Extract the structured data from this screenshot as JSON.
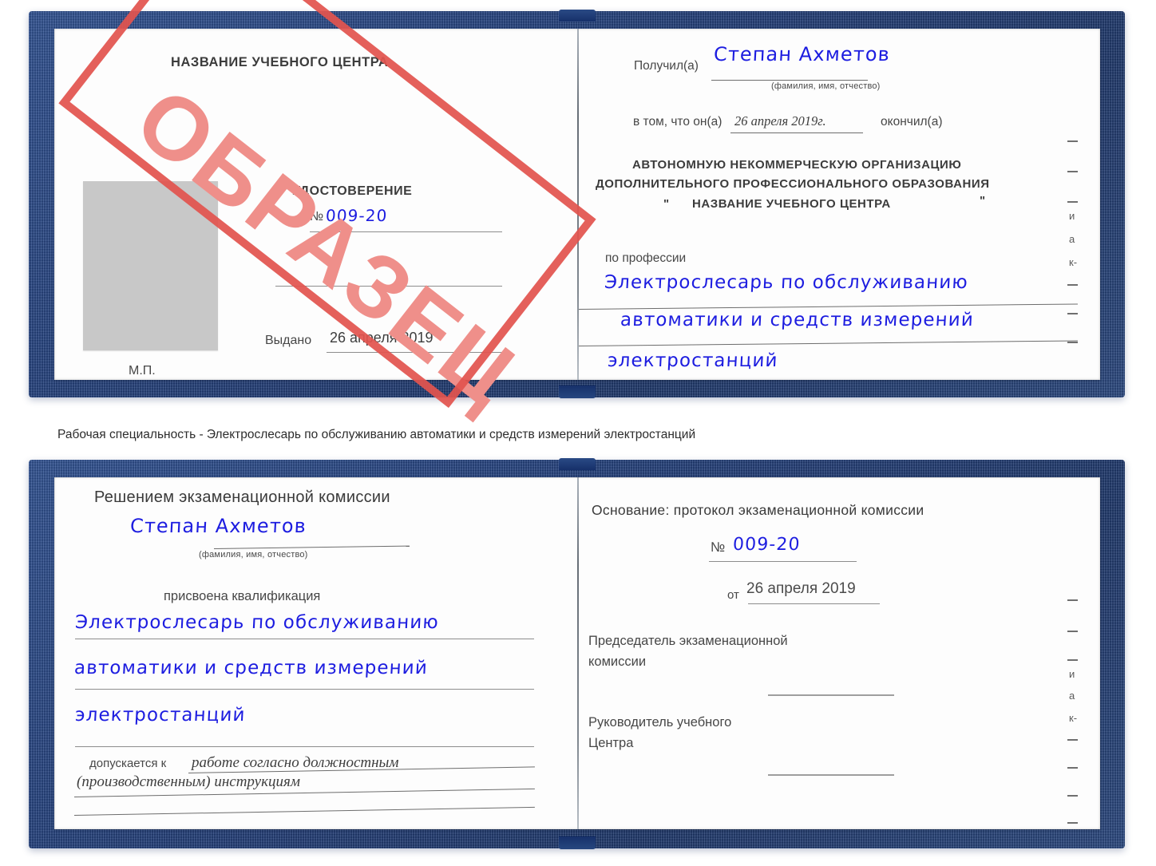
{
  "document": {
    "type": "Удостоверение",
    "watermark": {
      "text": "ОБРАЗЕЦ",
      "border_color": "#e2544f",
      "text_color": "#ef8f8a",
      "angle_deg": -38
    },
    "cover_color": "#1d3c7c",
    "handwriting_color": "#1d1de0"
  },
  "caption": {
    "text": "Рабочая специальность - Электрослесарь по обслуживанию автоматики и средств измерений электростанций"
  },
  "cert1": {
    "left_page": {
      "center_title": "НАЗВАНИЕ УЧЕБНОГО ЦЕНТРА",
      "doc_type": "УДОСТОВЕРЕНИЕ",
      "number_label": "№",
      "number_value": "009-20",
      "issued_label": "Выдано",
      "issued_date": "26 апреля 2019",
      "seal_label": "М.П.",
      "photo_placeholder": "photo-placeholder"
    },
    "right_page": {
      "received_label": "Получил(а)",
      "recipient_name": "Степан Ахметов",
      "name_hint": "(фамилия, имя, отчество)",
      "that_he_label": "в том, что он(а)",
      "completion_date": "26 апреля 2019г.",
      "graduated_label": "окончил(а)",
      "org_line1": "АВТОНОМНУЮ НЕКОММЕРЧЕСКУЮ ОРГАНИЗАЦИЮ",
      "org_line2": "ДОПОЛНИТЕЛЬНОГО ПРОФЕССИОНАЛЬНОГО ОБРАЗОВАНИЯ",
      "org_quote_open": "\"",
      "org_name": "НАЗВАНИЕ УЧЕБНОГО ЦЕНТРА",
      "org_quote_close": "\"",
      "profession_label": "по профессии",
      "profession_line1": "Электрослесарь по обслуживанию",
      "profession_line2": "автоматики и средств измерений",
      "profession_line3": "электростанций"
    }
  },
  "cert2": {
    "left_page": {
      "title": "Решением экзаменационной комиссии",
      "recipient_name": "Степан Ахметов",
      "name_hint": "(фамилия, имя, отчество)",
      "qualification_label": "присвоена квалификация",
      "qualification_line1": "Электрослесарь по обслуживанию",
      "qualification_line2": "автоматики и средств измерений",
      "qualification_line3": "электростанций",
      "admitted_label": "допускается к",
      "admitted_line1": "работе согласно должностным",
      "admitted_line2": "(производственным) инструкциям"
    },
    "right_page": {
      "basis_label": "Основание: протокол экзаменационной комиссии",
      "number_label": "№",
      "number_value": "009-20",
      "from_label": "от",
      "from_date": "26 апреля 2019",
      "chairman_line1": "Председатель экзаменационной",
      "chairman_line2": "комиссии",
      "head_line1": "Руководитель учебного",
      "head_line2": "Центра"
    }
  },
  "edge_fragments": {
    "f1": "и",
    "f2": "а",
    "f3": "к-"
  }
}
